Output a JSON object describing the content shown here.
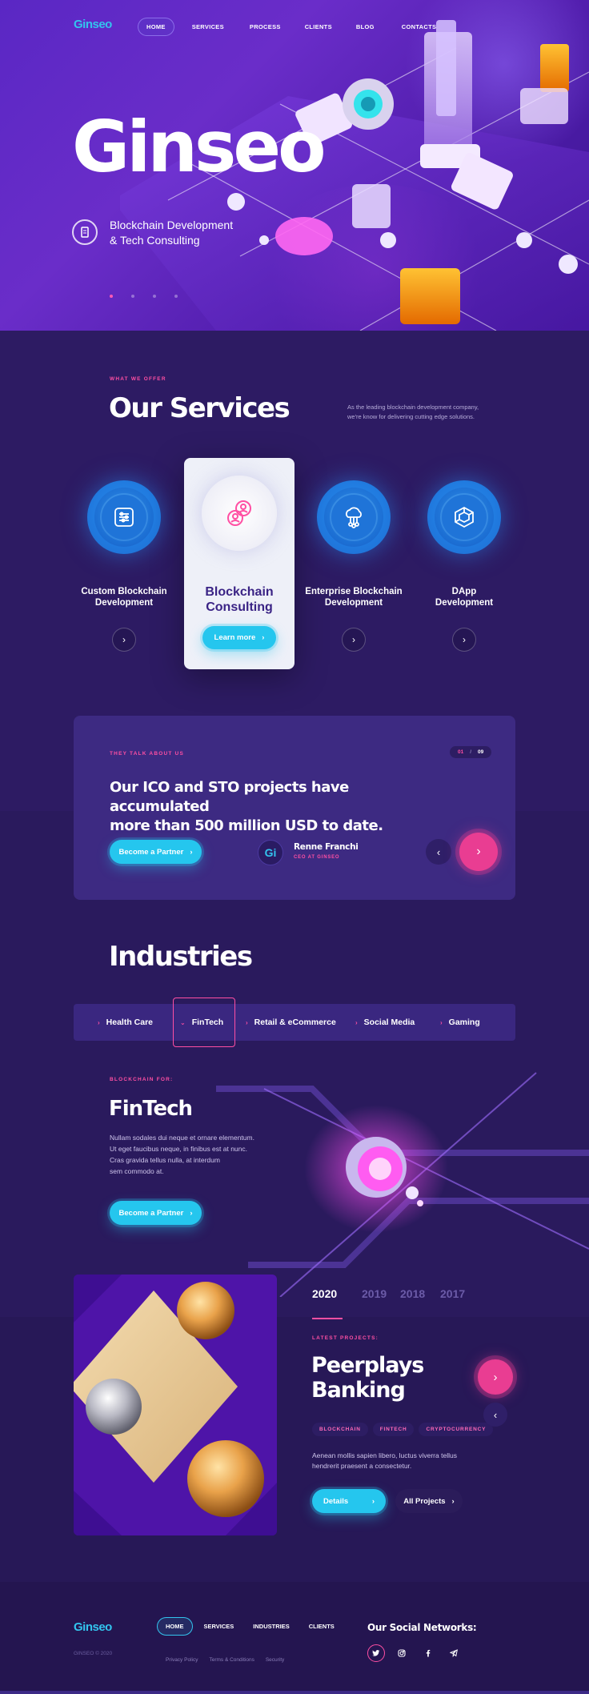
{
  "header": {
    "logo_text": "Ginseo",
    "nav": [
      "HOME",
      "SERVICES",
      "PROCESS",
      "CLIENTS",
      "BLOG",
      "CONTACTS"
    ]
  },
  "hero": {
    "title": "Ginseo",
    "subtitle_line1": "Blockchain Development",
    "subtitle_line2": "& Tech Consulting",
    "slides": 4,
    "active_slide": 1
  },
  "services": {
    "tag": "WHAT WE OFFER",
    "title": "Our Services",
    "desc_line1": "As the leading blockchain development company,",
    "desc_line2": "we're know for delivering cutting edge solutions.",
    "items": [
      {
        "line1": "Custom Blockchain",
        "line2": "Development"
      },
      {
        "line1": "Blockchain",
        "line2": "Consulting",
        "button": "Learn more"
      },
      {
        "line1": "Enterprise Blockchain",
        "line2": "Development"
      },
      {
        "line1": "DApp",
        "line2": "Development"
      }
    ]
  },
  "testimonials": {
    "tag": "THEY TALK ABOUT US",
    "counter_current": "01",
    "counter_sep": "/",
    "counter_total": "09",
    "quote_line1": "Our ICO and STO projects have accumulated",
    "quote_line2": "more than 500 million USD to date.",
    "cta": "Become a Partner",
    "author_initials": "Gi",
    "author_name": "Renne Franchi",
    "author_role": "CEO AT GINSEO"
  },
  "industries": {
    "title": "Industries",
    "tabs": [
      "Health Care",
      "FinTech",
      "Retail & eCommerce",
      "Social Media",
      "Gaming"
    ],
    "active_tab": "FinTech",
    "detail_tag": "BLOCKCHAIN FOR:",
    "detail_title": "FinTech",
    "detail_lines": [
      "Nullam sodales dui neque et ornare elementum.",
      "Ut eget faucibus neque, in finibus est at nunc.",
      "Cras gravida tellus nulla, at interdum",
      "sem commodo at."
    ],
    "cta": "Become a Partner"
  },
  "projects": {
    "years": [
      "2020",
      "2019",
      "2018",
      "2017"
    ],
    "active_year": "2020",
    "tag": "LATEST PROJECTS:",
    "title_line1": "Peerplays",
    "title_line2": "Banking",
    "chips": [
      "BLOCKCHAIN",
      "FINTECH",
      "CRYPTOCURRENCY"
    ],
    "desc_line1": "Aenean mollis sapien libero, luctus viverra tellus",
    "desc_line2": "hendrerit praesent a consectetur.",
    "details_btn": "Details",
    "all_btn": "All Projects"
  },
  "footer": {
    "logo_text": "Ginseo",
    "nav": [
      "HOME",
      "SERVICES",
      "INDUSTRIES",
      "CLIENTS"
    ],
    "social_title": "Our Social Networks:",
    "copyright": "GINSEO © 2020",
    "links": [
      "Privacy Policy",
      "Terms & Conditions",
      "Security"
    ],
    "social_icons": [
      "twitter-icon",
      "instagram-icon",
      "facebook-icon",
      "telegram-icon"
    ]
  },
  "colors": {
    "accent_pink": "#ff4fa3",
    "accent_cyan": "#25c6ee",
    "bg_dark": "#2a1a5e"
  }
}
